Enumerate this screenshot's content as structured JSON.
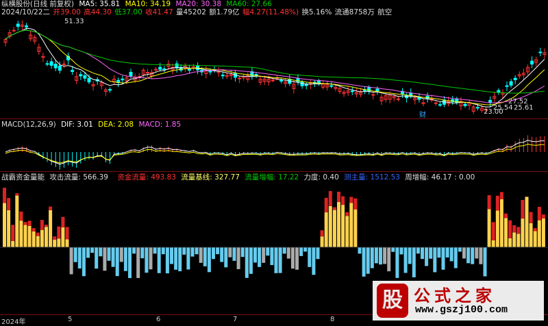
{
  "main": {
    "title": "纵横股份(日线 前复权)",
    "ma5": "MA5: 35.81",
    "ma10": "MA10: 34.19",
    "ma20": "MA20: 30.38",
    "ma60": "MA60: 27.66",
    "quote_date": "2024/10/22二",
    "open": "开39.00",
    "high": "高44.30",
    "low": "低37.00",
    "close": "收41.47",
    "volume": "量45202",
    "amount": "额1.79亿",
    "change": "幅4.27(11.48%)",
    "turnover": "换5.16%",
    "float_shares": "流通8758万",
    "sector": "航空",
    "price_label_high": "51.33",
    "price_label_low": "23.00",
    "price_label_a": "27.52",
    "price_label_b": "25.61",
    "price_label_c": "25.54",
    "financial_marker": "财"
  },
  "macd": {
    "title": "MACD(12,26,9)",
    "dif": "DIF: 3.01",
    "dea": "DEA: 2.08",
    "macd": "MACD: 1.85"
  },
  "capital": {
    "title": "战霸资金量能",
    "attack_flow": "攻击流量: 566.39",
    "fund_flow": "资金流量: 493.83",
    "flow_base": "流量基线: 327.77",
    "flow_increase": "流量增幅: 17.22",
    "strength": "力度: 0.40",
    "main_force": "测主量: 1512.53",
    "weekly_increase": "周增幅: 46.17",
    "tail": ": 0.00"
  },
  "x_axis": [
    "2024年",
    "5",
    "6",
    "7",
    "8"
  ],
  "watermark": {
    "logo_char": "股",
    "title": "公式之家",
    "url": "www.gszj100.com"
  },
  "colors": {
    "up": "#ff3333",
    "down": "#00ffff",
    "ma5": "#ffffff",
    "ma10": "#ffff00",
    "ma20": "#ff66ff",
    "ma60": "#00cc00",
    "vol_up": "#ffd34d",
    "vol_red": "#dd2222",
    "vol_down": "#66ccee",
    "vol_gray": "#aaaaaa"
  }
}
